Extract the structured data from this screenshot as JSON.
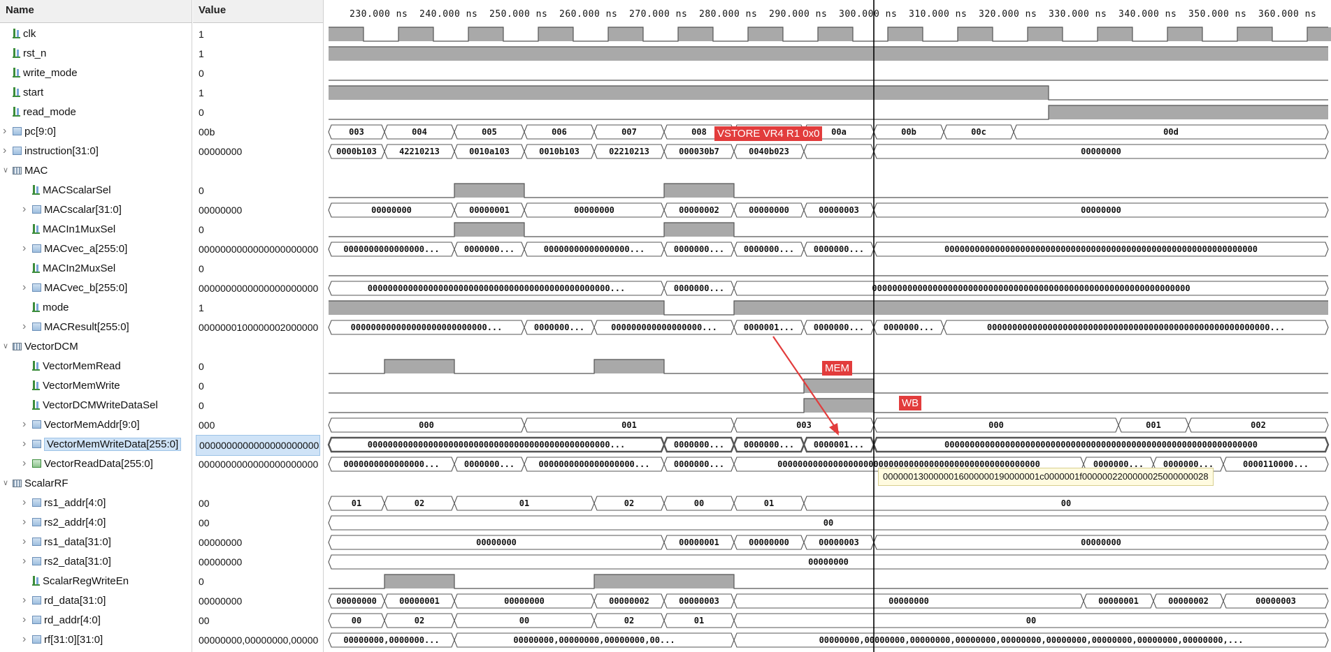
{
  "headers": {
    "name": "Name",
    "value": "Value"
  },
  "time_labels": [
    "230.000 ns",
    "240.000 ns",
    "250.000 ns",
    "260.000 ns",
    "270.000 ns",
    "280.000 ns",
    "290.000 ns",
    "300.000 ns",
    "310.000 ns",
    "320.000 ns",
    "330.000 ns",
    "340.000 ns",
    "350.000 ns",
    "360.000 ns"
  ],
  "rows": [
    {
      "name": "clk",
      "value": "1",
      "icon": "bit",
      "indent": 0,
      "wave": {
        "kind": "clock"
      }
    },
    {
      "name": "rst_n",
      "value": "1",
      "icon": "bit",
      "indent": 0,
      "wave": {
        "kind": "level",
        "segs": [
          [
            0,
            1430,
            1
          ]
        ]
      }
    },
    {
      "name": "write_mode",
      "value": "0",
      "icon": "bit",
      "indent": 0,
      "wave": {
        "kind": "level",
        "segs": [
          [
            0,
            1430,
            0
          ]
        ]
      }
    },
    {
      "name": "start",
      "value": "1",
      "icon": "bit",
      "indent": 0,
      "wave": {
        "kind": "level",
        "segs": [
          [
            0,
            1030,
            1
          ],
          [
            1030,
            1430,
            0
          ]
        ]
      }
    },
    {
      "name": "read_mode",
      "value": "0",
      "icon": "bit",
      "indent": 0,
      "wave": {
        "kind": "level",
        "segs": [
          [
            0,
            1030,
            0
          ],
          [
            1030,
            1430,
            1
          ]
        ]
      }
    },
    {
      "name": "pc[9:0]",
      "value": "00b",
      "icon": "bus",
      "indent": 0,
      "caret": ">",
      "wave": {
        "kind": "bus",
        "segs": [
          [
            0,
            80,
            "003"
          ],
          [
            80,
            180,
            "004"
          ],
          [
            180,
            280,
            "005"
          ],
          [
            280,
            380,
            "006"
          ],
          [
            380,
            480,
            "007"
          ],
          [
            480,
            580,
            "008"
          ],
          [
            580,
            680,
            "009"
          ],
          [
            680,
            780,
            "00a"
          ],
          [
            780,
            880,
            "00b"
          ],
          [
            880,
            980,
            "00c"
          ],
          [
            980,
            1430,
            "00d"
          ]
        ]
      }
    },
    {
      "name": "instruction[31:0]",
      "value": "00000000",
      "icon": "bus",
      "indent": 0,
      "caret": ">",
      "wave": {
        "kind": "bus",
        "segs": [
          [
            0,
            80,
            "0000b103"
          ],
          [
            80,
            180,
            "42210213"
          ],
          [
            180,
            280,
            "0010a103"
          ],
          [
            280,
            380,
            "0010b103"
          ],
          [
            380,
            480,
            "02210213"
          ],
          [
            480,
            580,
            "000030b7"
          ],
          [
            580,
            680,
            "0040b023"
          ],
          [
            680,
            780,
            ""
          ],
          [
            780,
            1430,
            "00000000"
          ]
        ]
      }
    },
    {
      "name": "MAC",
      "value": "",
      "icon": "group",
      "indent": 0,
      "caret": "v",
      "wave": {
        "kind": "none"
      }
    },
    {
      "name": "MACScalarSel",
      "value": "0",
      "icon": "bit",
      "indent": 1,
      "wave": {
        "kind": "level",
        "segs": [
          [
            0,
            180,
            0
          ],
          [
            180,
            280,
            1
          ],
          [
            280,
            480,
            0
          ],
          [
            480,
            580,
            1
          ],
          [
            580,
            1430,
            0
          ]
        ]
      }
    },
    {
      "name": "MACscalar[31:0]",
      "value": "00000000",
      "icon": "bus",
      "indent": 1,
      "caret": ">",
      "wave": {
        "kind": "bus",
        "segs": [
          [
            0,
            180,
            "00000000"
          ],
          [
            180,
            280,
            "00000001"
          ],
          [
            280,
            480,
            "00000000"
          ],
          [
            480,
            580,
            "00000002"
          ],
          [
            580,
            680,
            "00000000"
          ],
          [
            680,
            780,
            "00000003"
          ],
          [
            780,
            1430,
            "00000000"
          ]
        ]
      }
    },
    {
      "name": "MACIn1MuxSel",
      "value": "0",
      "icon": "bit",
      "indent": 1,
      "wave": {
        "kind": "level",
        "segs": [
          [
            0,
            180,
            0
          ],
          [
            180,
            280,
            1
          ],
          [
            280,
            480,
            0
          ],
          [
            480,
            580,
            1
          ],
          [
            580,
            1430,
            0
          ]
        ]
      }
    },
    {
      "name": "MACvec_a[255:0]",
      "value": "0000000000000000000000",
      "icon": "bus",
      "indent": 1,
      "caret": ">",
      "wave": {
        "kind": "bus",
        "segs": [
          [
            0,
            180,
            "0000000000000000..."
          ],
          [
            180,
            280,
            "0000000..."
          ],
          [
            280,
            480,
            "00000000000000000..."
          ],
          [
            480,
            580,
            "0000000..."
          ],
          [
            580,
            680,
            "0000000..."
          ],
          [
            680,
            780,
            "0000000..."
          ],
          [
            780,
            1430,
            "00000000000000000000000000000000000000000000000000000000000000"
          ]
        ]
      }
    },
    {
      "name": "MACIn2MuxSel",
      "value": "0",
      "icon": "bit",
      "indent": 1,
      "wave": {
        "kind": "level",
        "segs": [
          [
            0,
            1430,
            0
          ]
        ]
      }
    },
    {
      "name": "MACvec_b[255:0]",
      "value": "0000000000000000000000",
      "icon": "bus",
      "indent": 1,
      "caret": ">",
      "wave": {
        "kind": "bus",
        "segs": [
          [
            0,
            480,
            "000000000000000000000000000000000000000000000000..."
          ],
          [
            480,
            580,
            "0000000..."
          ],
          [
            580,
            1430,
            "000000000000000000000000000000000000000000000000000000000000000"
          ]
        ]
      }
    },
    {
      "name": "mode",
      "value": "1",
      "icon": "bit",
      "indent": 1,
      "wave": {
        "kind": "level",
        "segs": [
          [
            0,
            480,
            1
          ],
          [
            480,
            580,
            0
          ],
          [
            580,
            1430,
            1
          ]
        ]
      }
    },
    {
      "name": "MACResult[255:0]",
      "value": "0000000100000002000000",
      "icon": "bus",
      "indent": 1,
      "caret": ">",
      "wave": {
        "kind": "bus",
        "segs": [
          [
            0,
            280,
            "000000000000000000000000000..."
          ],
          [
            280,
            380,
            "0000000..."
          ],
          [
            380,
            580,
            "000000000000000000..."
          ],
          [
            580,
            680,
            "0000001..."
          ],
          [
            680,
            780,
            "0000000..."
          ],
          [
            780,
            880,
            "0000000..."
          ],
          [
            880,
            1430,
            "00000000000000000000000000000000000000000000000000000000..."
          ]
        ]
      }
    },
    {
      "name": "VectorDCM",
      "value": "",
      "icon": "group",
      "indent": 0,
      "caret": "v",
      "wave": {
        "kind": "none"
      }
    },
    {
      "name": "VectorMemRead",
      "value": "0",
      "icon": "bit",
      "indent": 1,
      "wave": {
        "kind": "level",
        "segs": [
          [
            0,
            80,
            0
          ],
          [
            80,
            180,
            1
          ],
          [
            180,
            380,
            0
          ],
          [
            380,
            480,
            1
          ],
          [
            480,
            1430,
            0
          ]
        ]
      }
    },
    {
      "name": "VectorMemWrite",
      "value": "0",
      "icon": "bit",
      "indent": 1,
      "wave": {
        "kind": "level",
        "segs": [
          [
            0,
            680,
            0
          ],
          [
            680,
            780,
            1
          ],
          [
            780,
            1430,
            0
          ]
        ]
      }
    },
    {
      "name": "VectorDCMWriteDataSel",
      "value": "0",
      "icon": "bit",
      "indent": 1,
      "wave": {
        "kind": "level",
        "segs": [
          [
            0,
            680,
            0
          ],
          [
            680,
            780,
            1
          ],
          [
            780,
            1430,
            0
          ]
        ]
      }
    },
    {
      "name": "VectorMemAddr[9:0]",
      "value": "000",
      "icon": "bus",
      "indent": 1,
      "caret": ">",
      "wave": {
        "kind": "bus",
        "segs": [
          [
            0,
            280,
            "000"
          ],
          [
            280,
            580,
            "001"
          ],
          [
            580,
            780,
            "003"
          ],
          [
            780,
            1130,
            "000"
          ],
          [
            1130,
            1230,
            "001"
          ],
          [
            1230,
            1430,
            "002"
          ]
        ]
      }
    },
    {
      "name": "VectorMemWriteData[255:0]",
      "value": "0000000000000000000000",
      "icon": "bus",
      "indent": 1,
      "caret": ">",
      "selected": true,
      "wave": {
        "kind": "bus",
        "bold": true,
        "segs": [
          [
            0,
            480,
            "000000000000000000000000000000000000000000000000..."
          ],
          [
            480,
            580,
            "0000000..."
          ],
          [
            580,
            680,
            "0000000..."
          ],
          [
            680,
            780,
            "0000001..."
          ],
          [
            780,
            1430,
            "00000000000000000000000000000000000000000000000000000000000000"
          ]
        ]
      }
    },
    {
      "name": "VectorReadData[255:0]",
      "value": "0000000000000000000000",
      "icon": "busgreen",
      "indent": 1,
      "caret": ">",
      "wave": {
        "kind": "bus",
        "segs": [
          [
            0,
            180,
            "0000000000000000..."
          ],
          [
            180,
            280,
            "0000000..."
          ],
          [
            280,
            480,
            "0000000000000000000..."
          ],
          [
            480,
            580,
            "0000000..."
          ],
          [
            580,
            1080,
            "0000000000000000000000000000000000000000000000000000"
          ],
          [
            1080,
            1180,
            "0000000..."
          ],
          [
            1180,
            1280,
            "0000000..."
          ],
          [
            1280,
            1430,
            "0000110000..."
          ]
        ]
      }
    },
    {
      "name": "ScalarRF",
      "value": "",
      "icon": "group",
      "indent": 0,
      "caret": "v",
      "wave": {
        "kind": "none"
      }
    },
    {
      "name": "rs1_addr[4:0]",
      "value": "00",
      "icon": "bus",
      "indent": 1,
      "caret": ">",
      "wave": {
        "kind": "bus",
        "segs": [
          [
            0,
            80,
            "01"
          ],
          [
            80,
            180,
            "02"
          ],
          [
            180,
            380,
            "01"
          ],
          [
            380,
            480,
            "02"
          ],
          [
            480,
            580,
            "00"
          ],
          [
            580,
            680,
            "01"
          ],
          [
            680,
            1430,
            "00"
          ]
        ]
      }
    },
    {
      "name": "rs2_addr[4:0]",
      "value": "00",
      "icon": "bus",
      "indent": 1,
      "caret": ">",
      "wave": {
        "kind": "bus",
        "segs": [
          [
            0,
            1430,
            "00"
          ]
        ]
      }
    },
    {
      "name": "rs1_data[31:0]",
      "value": "00000000",
      "icon": "bus",
      "indent": 1,
      "caret": ">",
      "wave": {
        "kind": "bus",
        "segs": [
          [
            0,
            480,
            "00000000"
          ],
          [
            480,
            580,
            "00000001"
          ],
          [
            580,
            680,
            "00000000"
          ],
          [
            680,
            780,
            "00000003"
          ],
          [
            780,
            1430,
            "00000000"
          ]
        ]
      }
    },
    {
      "name": "rs2_data[31:0]",
      "value": "00000000",
      "icon": "bus",
      "indent": 1,
      "caret": ">",
      "wave": {
        "kind": "bus",
        "segs": [
          [
            0,
            1430,
            "00000000"
          ]
        ]
      }
    },
    {
      "name": "ScalarRegWriteEn",
      "value": "0",
      "icon": "bit",
      "indent": 1,
      "wave": {
        "kind": "level",
        "segs": [
          [
            0,
            80,
            0
          ],
          [
            80,
            180,
            1
          ],
          [
            180,
            380,
            0
          ],
          [
            380,
            580,
            1
          ],
          [
            580,
            1430,
            0
          ]
        ]
      }
    },
    {
      "name": "rd_data[31:0]",
      "value": "00000000",
      "icon": "bus",
      "indent": 1,
      "caret": ">",
      "wave": {
        "kind": "bus",
        "segs": [
          [
            0,
            80,
            "00000000"
          ],
          [
            80,
            180,
            "00000001"
          ],
          [
            180,
            380,
            "00000000"
          ],
          [
            380,
            480,
            "00000002"
          ],
          [
            480,
            580,
            "00000003"
          ],
          [
            580,
            1080,
            "00000000"
          ],
          [
            1080,
            1180,
            "00000001"
          ],
          [
            1180,
            1280,
            "00000002"
          ],
          [
            1280,
            1430,
            "00000003"
          ]
        ]
      }
    },
    {
      "name": "rd_addr[4:0]",
      "value": "00",
      "icon": "bus",
      "indent": 1,
      "caret": ">",
      "wave": {
        "kind": "bus",
        "segs": [
          [
            0,
            80,
            "00"
          ],
          [
            80,
            180,
            "02"
          ],
          [
            180,
            380,
            "00"
          ],
          [
            380,
            480,
            "02"
          ],
          [
            480,
            580,
            "01"
          ],
          [
            580,
            1430,
            "00"
          ]
        ]
      }
    },
    {
      "name": "rf[31:0][31:0]",
      "value": "00000000,00000000,00000",
      "icon": "bus",
      "indent": 1,
      "caret": ">",
      "wave": {
        "kind": "bus",
        "segs": [
          [
            0,
            180,
            "00000000,0000000..."
          ],
          [
            180,
            580,
            "00000000,00000000,00000000,00..."
          ],
          [
            580,
            1430,
            "00000000,00000000,00000000,00000000,00000000,00000000,00000000,00000000,00000000,..."
          ]
        ]
      }
    }
  ],
  "annotations": {
    "vstore": "VSTORE VR4 R1 0x0",
    "mem": "MEM",
    "wb": "WB"
  },
  "tooltip": "0000001300000016000000190000001c0000001f0000002200000025000000028",
  "colors": {
    "level_fill": "#a9a9a9",
    "wave_line": "#555555",
    "cursor": "#000000",
    "annotation": "#e23c3c"
  }
}
